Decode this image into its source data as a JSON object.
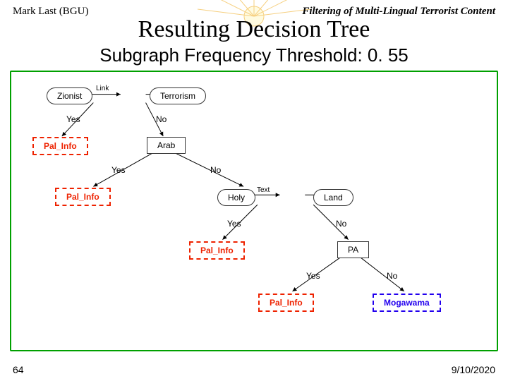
{
  "header": {
    "author": "Mark Last (BGU)",
    "topic": "Filtering of Multi-Lingual Terrorist Content"
  },
  "title": "Resulting Decision Tree",
  "subtitle": "Subgraph Frequency Threshold:  0. 55",
  "footer": {
    "page": "64",
    "date": "9/10/2020"
  },
  "tree": {
    "root": {
      "pattern": [
        "Zionist",
        "Link",
        "Terrorism"
      ],
      "yes": {
        "leaf": "Pal_Info",
        "class": "red"
      },
      "no": {
        "test": "Arab",
        "yes": {
          "leaf": "Pal_Info",
          "class": "red"
        },
        "no": {
          "pattern": [
            "Holy",
            "Text",
            "Land"
          ],
          "yes": {
            "leaf": "Pal_Info",
            "class": "red"
          },
          "no": {
            "test": "PA",
            "yes": {
              "leaf": "Pal_Info",
              "class": "red"
            },
            "no": {
              "leaf": "Mogawama",
              "class": "blue"
            }
          }
        }
      }
    }
  },
  "labels": {
    "yes": "Yes",
    "no": "No",
    "link_label": "Link",
    "text_label": "Text"
  }
}
